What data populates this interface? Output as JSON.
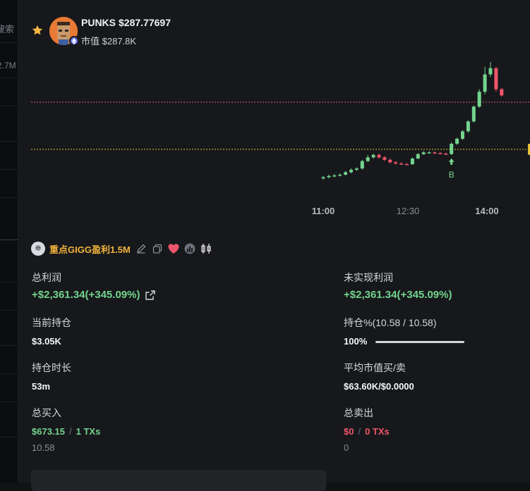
{
  "background": {
    "search_fragment": "搜索",
    "value_fragment": "2.7M"
  },
  "token": {
    "symbol": "PUNKS",
    "price": "$287.77697",
    "market_cap_label": "市值",
    "market_cap_value": "$287.8K",
    "favorited": true
  },
  "chart_data": {
    "type": "candlestick",
    "x_ticks": [
      "11:00",
      "12:30",
      "14:00"
    ],
    "marker_label": "B",
    "reference_lines": [
      {
        "style": "dotted",
        "color": "#d95a7a"
      },
      {
        "style": "dotted",
        "color": "#e8c33c"
      }
    ],
    "colors": {
      "up": "#73d48e",
      "down": "#f0566b"
    },
    "candles": [
      {
        "o": 1.0,
        "c": 1.05,
        "h": 1.1,
        "l": 0.95
      },
      {
        "o": 1.05,
        "c": 1.1,
        "h": 1.15,
        "l": 1.0
      },
      {
        "o": 1.1,
        "c": 1.12,
        "h": 1.18,
        "l": 1.05
      },
      {
        "o": 1.12,
        "c": 1.15,
        "h": 1.2,
        "l": 1.08
      },
      {
        "o": 1.15,
        "c": 1.25,
        "h": 1.3,
        "l": 1.12
      },
      {
        "o": 1.25,
        "c": 1.35,
        "h": 1.4,
        "l": 1.2
      },
      {
        "o": 1.35,
        "c": 1.4,
        "h": 1.45,
        "l": 1.3
      },
      {
        "o": 1.4,
        "c": 1.7,
        "h": 1.75,
        "l": 1.35
      },
      {
        "o": 1.7,
        "c": 1.85,
        "h": 1.95,
        "l": 1.65
      },
      {
        "o": 1.85,
        "c": 1.95,
        "h": 2.0,
        "l": 1.8
      },
      {
        "o": 1.95,
        "c": 1.85,
        "h": 2.0,
        "l": 1.8
      },
      {
        "o": 1.85,
        "c": 1.75,
        "h": 1.9,
        "l": 1.7
      },
      {
        "o": 1.75,
        "c": 1.65,
        "h": 1.8,
        "l": 1.6
      },
      {
        "o": 1.65,
        "c": 1.6,
        "h": 1.7,
        "l": 1.55
      },
      {
        "o": 1.6,
        "c": 1.58,
        "h": 1.65,
        "l": 1.55
      },
      {
        "o": 1.58,
        "c": 1.57,
        "h": 1.62,
        "l": 1.55
      },
      {
        "o": 1.57,
        "c": 1.8,
        "h": 1.85,
        "l": 1.55
      },
      {
        "o": 1.8,
        "c": 1.98,
        "h": 2.02,
        "l": 1.78
      },
      {
        "o": 1.98,
        "c": 2.05,
        "h": 2.1,
        "l": 1.95
      },
      {
        "o": 2.05,
        "c": 2.05,
        "h": 2.1,
        "l": 2.0
      },
      {
        "o": 2.05,
        "c": 2.02,
        "h": 2.08,
        "l": 1.98
      },
      {
        "o": 2.02,
        "c": 2.0,
        "h": 2.06,
        "l": 1.97
      },
      {
        "o": 2.0,
        "c": 1.98,
        "h": 2.04,
        "l": 1.95
      },
      {
        "o": 1.98,
        "c": 2.4,
        "h": 2.45,
        "l": 1.95
      },
      {
        "o": 2.4,
        "c": 2.6,
        "h": 2.65,
        "l": 2.35
      },
      {
        "o": 2.6,
        "c": 2.9,
        "h": 2.95,
        "l": 2.55
      },
      {
        "o": 2.9,
        "c": 3.3,
        "h": 3.35,
        "l": 2.85
      },
      {
        "o": 3.3,
        "c": 3.9,
        "h": 3.95,
        "l": 3.25
      },
      {
        "o": 3.9,
        "c": 4.5,
        "h": 4.6,
        "l": 3.85
      },
      {
        "o": 4.5,
        "c": 5.2,
        "h": 5.5,
        "l": 4.4
      },
      {
        "o": 5.2,
        "c": 5.45,
        "h": 5.7,
        "l": 5.1
      },
      {
        "o": 5.45,
        "c": 4.6,
        "h": 5.5,
        "l": 4.5
      },
      {
        "o": 4.6,
        "c": 4.35,
        "h": 4.65,
        "l": 4.3
      }
    ]
  },
  "trader": {
    "name": "重点GIGG盈利1.5M"
  },
  "stats": {
    "total_profit": {
      "label": "总利润",
      "value": "+$2,361.34(+345.09%)"
    },
    "unrealized_profit": {
      "label": "未实现利润",
      "value": "+$2,361.34(+345.09%)"
    },
    "current_holding": {
      "label": "当前持仓",
      "value": "$3.05K"
    },
    "holding_pct": {
      "label": "持仓%(10.58 / 10.58)",
      "value": "100%",
      "progress": 1.0
    },
    "holding_time": {
      "label": "持仓时长",
      "value": "53m"
    },
    "avg_mcap": {
      "label": "平均市值买/卖",
      "value": "$63.60K/$0.0000"
    },
    "total_buy": {
      "label": "总买入",
      "amount": "$673.15",
      "sep": "/",
      "txs": "1 TXs",
      "sub": "10.58"
    },
    "total_sell": {
      "label": "总卖出",
      "amount": "$0",
      "sep": "/",
      "txs": "0 TXs",
      "sub": "0"
    }
  }
}
